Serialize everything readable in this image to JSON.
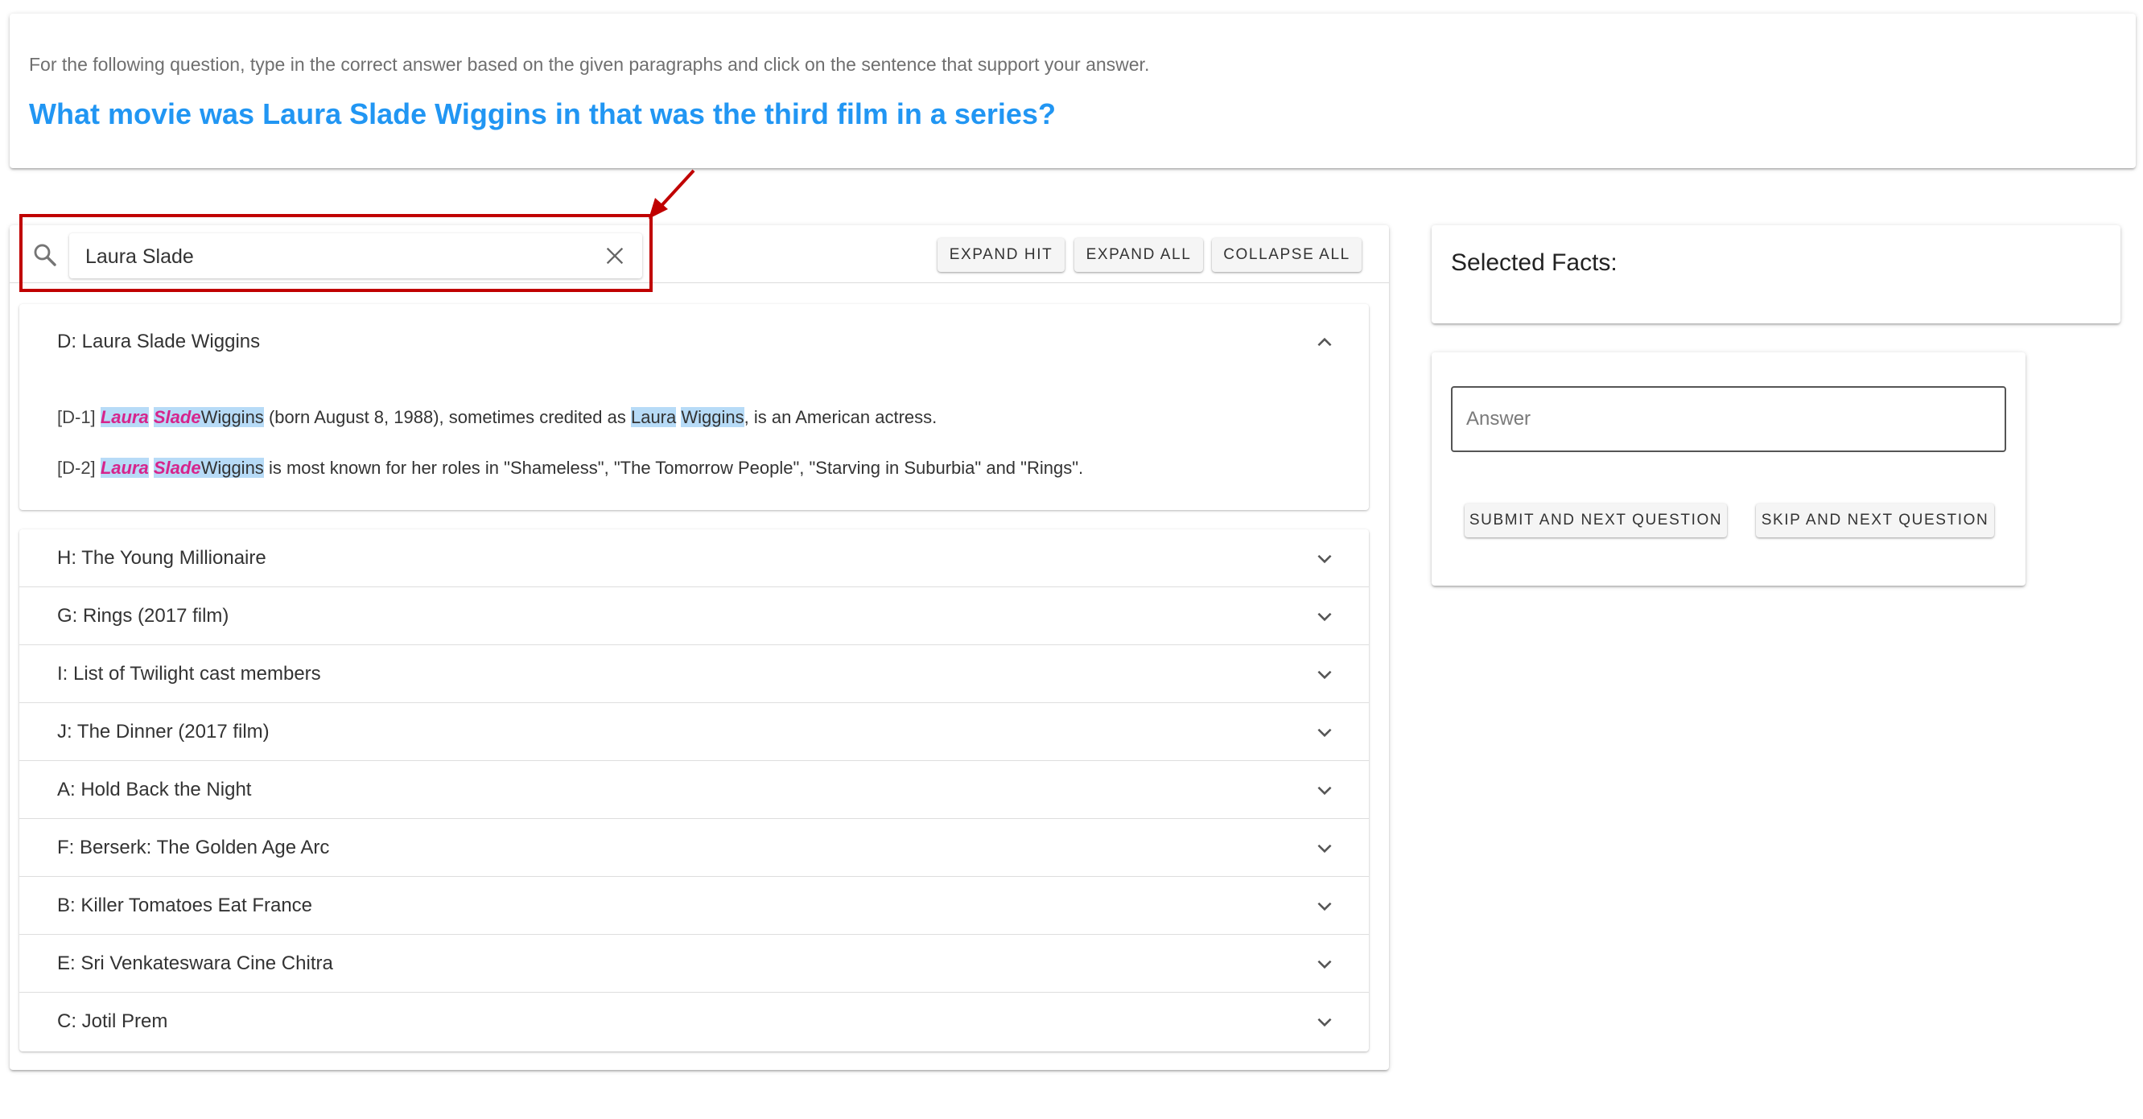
{
  "header": {
    "instruction": "For the following question, type in the correct answer based on the given paragraphs and click on the sentence that support your answer.",
    "question": "What movie was Laura Slade Wiggins in that was the third film in a series?"
  },
  "search": {
    "value": "Laura Slade",
    "icon": "search-icon",
    "clear_icon": "close-icon"
  },
  "toolbar": {
    "expand_hit": "EXPAND HIT",
    "expand_all": "EXPAND ALL",
    "collapse_all": "COLLAPSE ALL"
  },
  "expanded_doc": {
    "title": "D: Laura Slade Wiggins",
    "sentences": [
      {
        "tag": "[D-1]",
        "w1": "Laura",
        "w2": "Slade",
        "w3": "Wiggins",
        "mid": "(born August 8, 1988), sometimes credited as",
        "w4": "Laura",
        "w5": "Wiggins",
        "end": ", is an American actress."
      },
      {
        "tag": "[D-2]",
        "w1": "Laura",
        "w2": "Slade",
        "w3": "Wiggins",
        "rest": "is most known for her roles in \"Shameless\", \"The Tomorrow People\", \"Starving in Suburbia\" and \"Rings\"."
      }
    ]
  },
  "collapsed_docs": [
    "H: The Young Millionaire",
    "G: Rings (2017 film)",
    "I: List of Twilight cast members",
    "J: The Dinner (2017 film)",
    "A: Hold Back the Night",
    "F: Berserk: The Golden Age Arc",
    "B: Killer Tomatoes Eat France",
    "E: Sri Venkateswara Cine Chitra",
    "C: Jotil Prem"
  ],
  "facts": {
    "title": "Selected Facts:"
  },
  "answer": {
    "placeholder": "Answer",
    "submit_label": "SUBMIT AND NEXT QUESTION",
    "skip_label": "SKIP AND NEXT QUESTION"
  },
  "colors": {
    "question": "#2196f3",
    "annotation": "#c00000",
    "highlight": "#b7dbf7",
    "match": "#d6248c"
  }
}
